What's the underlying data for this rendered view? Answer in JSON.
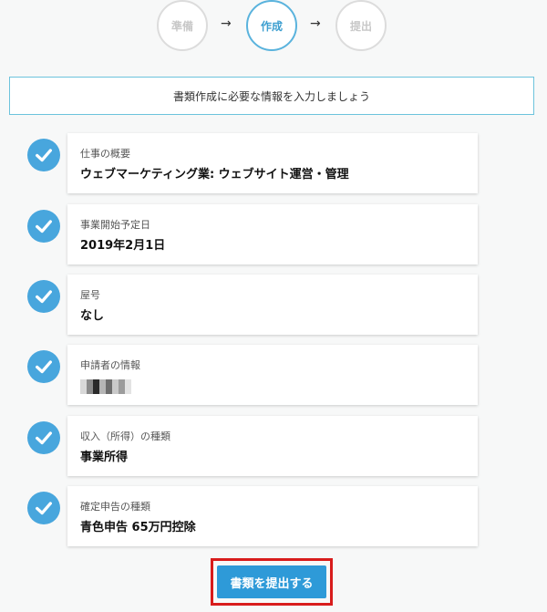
{
  "stepper": {
    "steps": [
      {
        "label": "準備",
        "state": "inactive"
      },
      {
        "label": "作成",
        "state": "active"
      },
      {
        "label": "提出",
        "state": "inactive"
      }
    ],
    "arrow": "→"
  },
  "instruction": "書類作成に必要な情報を入力しましょう",
  "items": [
    {
      "label": "仕事の概要",
      "value": "ウェブマーケティング業: ウェブサイト運営・管理"
    },
    {
      "label": "事業開始予定日",
      "value": "2019年2月1日"
    },
    {
      "label": "屋号",
      "value": "なし"
    },
    {
      "label": "申請者の情報",
      "value": null,
      "redacted": true
    },
    {
      "label": "収入（所得）の種類",
      "value": "事業所得"
    },
    {
      "label": "確定申告の種類",
      "value": "青色申告 65万円控除"
    }
  ],
  "submit": {
    "label": "書類を提出する"
  },
  "colors": {
    "accent": "#48a6dd",
    "button": "#2e9ad8",
    "highlight_frame": "#d81c1c",
    "instruction_border": "#6cc3dc"
  }
}
